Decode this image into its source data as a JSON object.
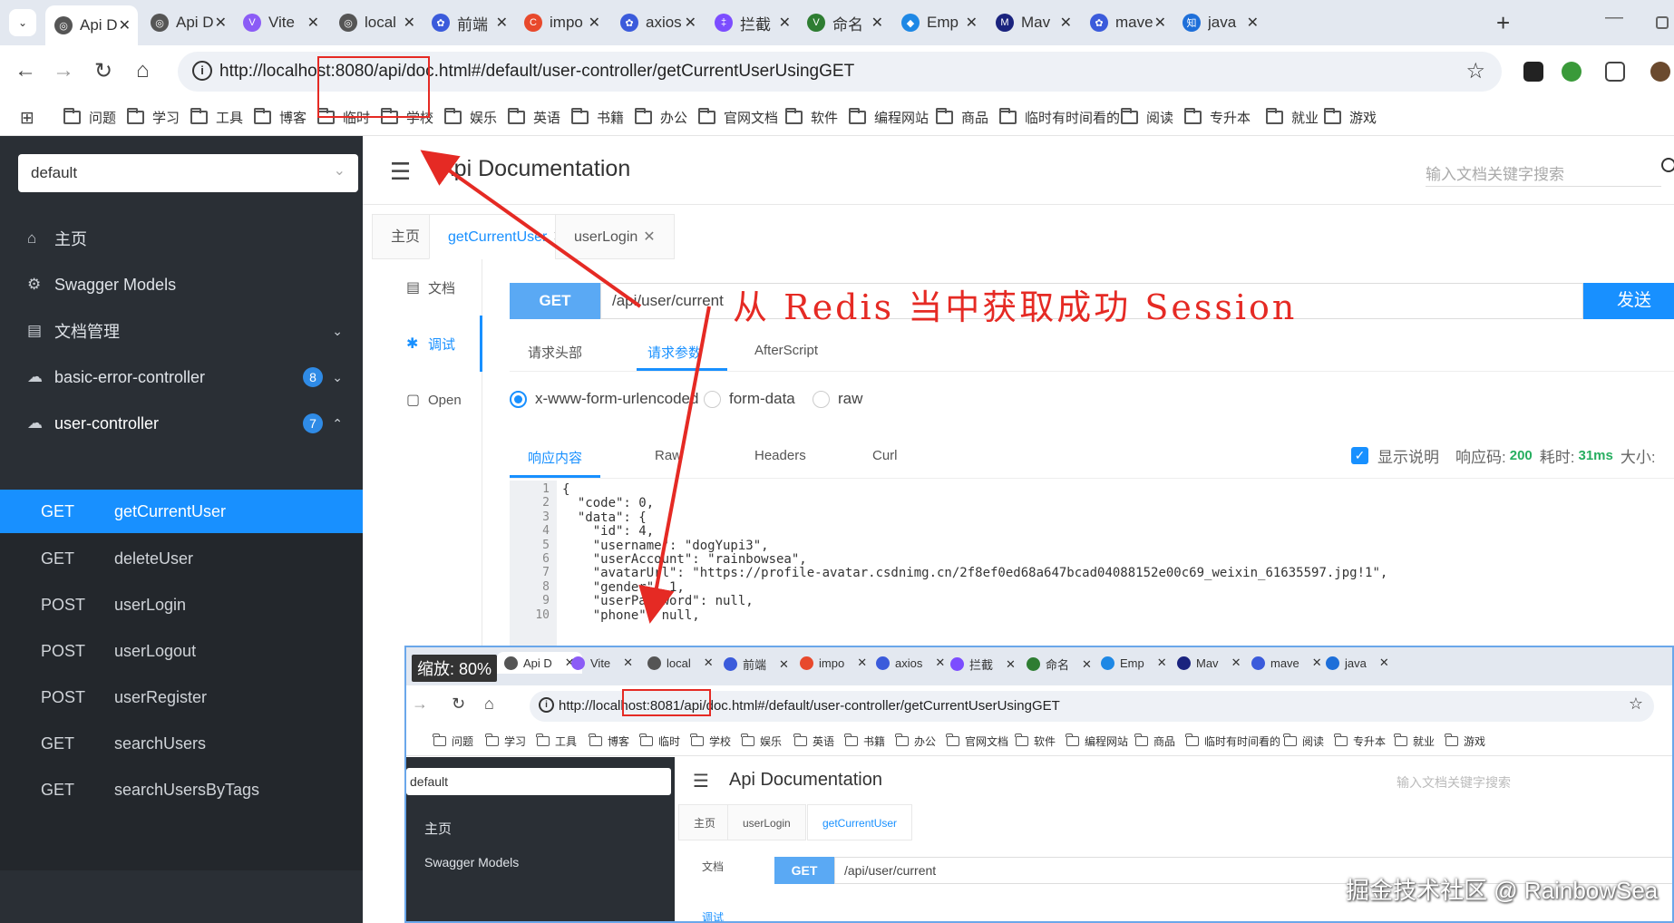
{
  "browser": {
    "tabs": [
      {
        "title": "Api D",
        "color": "#555555",
        "glyph": "◎"
      },
      {
        "title": "Api D",
        "color": "#555555",
        "glyph": "◎"
      },
      {
        "title": "Vite",
        "color": "#8b5cf6",
        "glyph": "V"
      },
      {
        "title": "local",
        "color": "#555555",
        "glyph": "◎"
      },
      {
        "title": "前端",
        "color": "#3b5bdb",
        "glyph": "✿"
      },
      {
        "title": "impo",
        "color": "#e8492c",
        "glyph": "C"
      },
      {
        "title": "axios",
        "color": "#3b5bdb",
        "glyph": "✿"
      },
      {
        "title": "拦截",
        "color": "#7c4dff",
        "glyph": "‡"
      },
      {
        "title": "命名",
        "color": "#2e7d32",
        "glyph": "V"
      },
      {
        "title": "Emp",
        "color": "#1e88e5",
        "glyph": "◆"
      },
      {
        "title": "Mav",
        "color": "#1a237e",
        "glyph": "M"
      },
      {
        "title": "mave",
        "color": "#3b5bdb",
        "glyph": "✿"
      },
      {
        "title": "java",
        "color": "#1e6fd9",
        "glyph": "知"
      }
    ],
    "tab_close": "✕",
    "new_tab": "+",
    "url": "http://localhost:8080/api/doc.html#/default/user-controller/getCurrentUserUsingGET",
    "bookmarks": [
      "问题",
      "学习",
      "工具",
      "博客",
      "临时",
      "学校",
      "娱乐",
      "英语",
      "书籍",
      "办公",
      "官网文档",
      "软件",
      "编程网站",
      "商品",
      "临时有时间看的",
      "阅读",
      "专升本",
      "就业",
      "游戏"
    ]
  },
  "sidebar": {
    "group_select": "default",
    "items": [
      {
        "label": "主页",
        "icon": "⌂"
      },
      {
        "label": "Swagger Models",
        "icon": "⚙"
      },
      {
        "label": "文档管理",
        "icon": "▤",
        "chevron": "⌄"
      },
      {
        "label": "basic-error-controller",
        "icon": "☁",
        "badge": "8",
        "chevron": "⌄"
      },
      {
        "label": "user-controller",
        "icon": "☁",
        "badge": "7",
        "chevron": "⌃"
      }
    ],
    "apis": [
      {
        "method": "GET",
        "name": "getCurrentUser"
      },
      {
        "method": "GET",
        "name": "deleteUser"
      },
      {
        "method": "POST",
        "name": "userLogin"
      },
      {
        "method": "POST",
        "name": "userLogout"
      },
      {
        "method": "POST",
        "name": "userRegister"
      },
      {
        "method": "GET",
        "name": "searchUsers"
      },
      {
        "method": "GET",
        "name": "searchUsersByTags"
      }
    ]
  },
  "main": {
    "title": "Api Documentation",
    "search_placeholder": "输入文档关键字搜索",
    "tabs": [
      {
        "label": "主页"
      },
      {
        "label": "getCurrentUser",
        "close": "✕"
      },
      {
        "label": "userLogin",
        "close": "✕"
      }
    ],
    "left_nav": [
      {
        "label": "文档",
        "icon": "▤"
      },
      {
        "label": "调试",
        "icon": "✱"
      },
      {
        "label": "Open",
        "icon": "▢"
      }
    ],
    "method": "GET",
    "request_path": "/api/user/current",
    "send_label": "发送",
    "param_tabs": [
      "请求头部",
      "请求参数",
      "AfterScript"
    ],
    "body_types": [
      "x-www-form-urlencoded",
      "form-data",
      "raw"
    ],
    "response_tabs": [
      "响应内容",
      "Raw",
      "Headers",
      "Curl"
    ],
    "show_desc": "显示说明",
    "status_label": "响应码:",
    "status_code": "200",
    "time_label": "耗时:",
    "time_value": "31ms",
    "size_label": "大小:",
    "code_lines": [
      {
        "n": "1",
        "t": "{"
      },
      {
        "n": "2",
        "t": "  \"code\": 0,"
      },
      {
        "n": "3",
        "t": "  \"data\": {"
      },
      {
        "n": "4",
        "t": "    \"id\": 4,"
      },
      {
        "n": "5",
        "t": "    \"username\": \"dogYupi3\","
      },
      {
        "n": "6",
        "t": "    \"userAccount\": \"rainbowsea\","
      },
      {
        "n": "7",
        "t": "    \"avatarUrl\": \"https://profile-avatar.csdnimg.cn/2f8ef0ed68a647bcad04088152e00c69_weixin_61635597.jpg!1\","
      },
      {
        "n": "8",
        "t": "    \"gender\": 1,"
      },
      {
        "n": "9",
        "t": "    \"userPassword\": null,"
      },
      {
        "n": "10",
        "t": "    \"phone\": null,"
      }
    ]
  },
  "annotation": {
    "text": "从 Redis 当中获取成功 Session",
    "color": "#e52a24"
  },
  "inset": {
    "zoom": "缩放: 80%",
    "tabs": [
      "Api D",
      "Vite",
      "local",
      "前端",
      "impo",
      "axios",
      "拦截",
      "命名",
      "Emp",
      "Mav",
      "mave",
      "java"
    ],
    "url": "http://localhost:8081/api/doc.html#/default/user-controller/getCurrentUserUsingGET",
    "bookmarks": [
      "问题",
      "学习",
      "工具",
      "博客",
      "临时",
      "学校",
      "娱乐",
      "英语",
      "书籍",
      "办公",
      "官网文档",
      "软件",
      "编程网站",
      "商品",
      "临时有时间看的",
      "阅读",
      "专升本",
      "就业",
      "游戏"
    ],
    "group_select": "default",
    "menu": [
      "主页",
      "Swagger Models"
    ],
    "title": "Api Documentation",
    "search_placeholder": "输入文档关键字搜索",
    "tabs_page": [
      "主页",
      "userLogin",
      "getCurrentUser"
    ],
    "left_nav": [
      "文档",
      "调试"
    ],
    "method": "GET",
    "request_path": "/api/user/current"
  },
  "watermark": "掘金技术社区 @ RainbowSea"
}
